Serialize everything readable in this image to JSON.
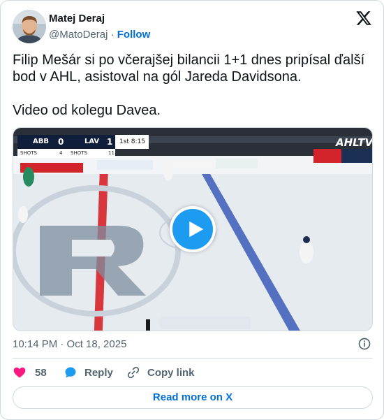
{
  "author": {
    "name": "Matej Deraj",
    "handle": "@MatoDeraj",
    "separator": "·",
    "follow_label": "Follow"
  },
  "tweet": {
    "text": "Filip Mešár si po včerajšej bilancii 1+1 dnes pripísal ďalší bod v AHL, asistoval na gól Jareda Davidsona.\n\nVideo od kolegu Davea.",
    "timestamp": "10:14 PM · Oct 18, 2025"
  },
  "video": {
    "scorebug": {
      "team1": "ABB",
      "score1": "0",
      "team2": "LAV",
      "score2": "1",
      "period": "1st  8:15",
      "shots_label": "SHOTS",
      "shots1": "4",
      "shots2": "11"
    },
    "broadcaster": "AHLTV",
    "play_icon": "play-icon"
  },
  "actions": {
    "like_count": "58",
    "reply_label": "Reply",
    "copy_label": "Copy link"
  },
  "read_more_label": "Read more on X",
  "colors": {
    "accent": "#1d9bf0",
    "link": "#006fd6",
    "like": "#f91880",
    "secondary_text": "#536471",
    "border": "#cfd9de"
  }
}
